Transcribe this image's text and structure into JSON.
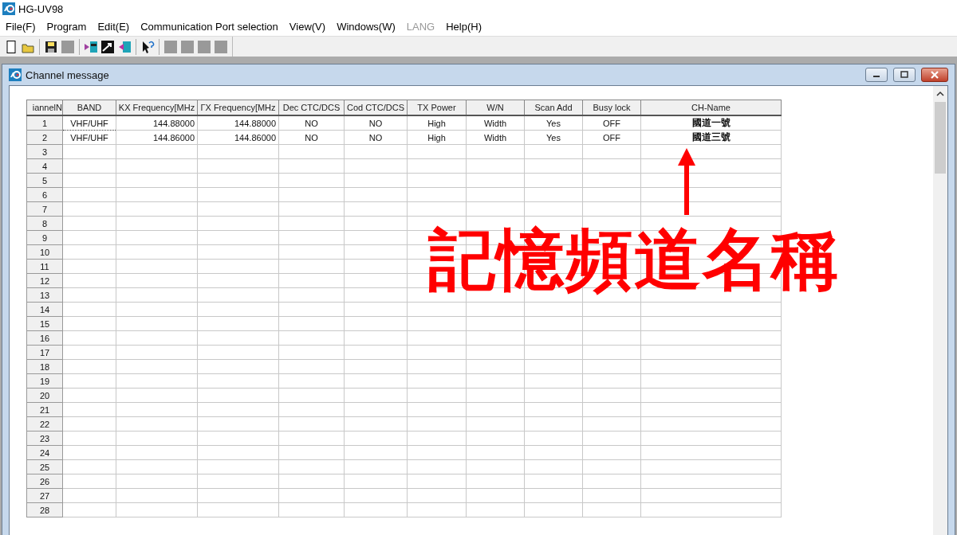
{
  "window": {
    "title": "HG-UV98"
  },
  "menu": [
    {
      "label": "File(F)",
      "disabled": false
    },
    {
      "label": "Program",
      "disabled": false
    },
    {
      "label": "Edit(E)",
      "disabled": false
    },
    {
      "label": "Communication Port selection",
      "disabled": false
    },
    {
      "label": "View(V)",
      "disabled": false
    },
    {
      "label": "Windows(W)",
      "disabled": false
    },
    {
      "label": "LANG",
      "disabled": true
    },
    {
      "label": "Help(H)",
      "disabled": false
    }
  ],
  "toolbar": [
    {
      "kind": "new"
    },
    {
      "kind": "open"
    },
    {
      "kind": "sep"
    },
    {
      "kind": "save"
    },
    {
      "kind": "blank"
    },
    {
      "kind": "sep"
    },
    {
      "kind": "read"
    },
    {
      "kind": "write"
    },
    {
      "kind": "transfer"
    },
    {
      "kind": "sep"
    },
    {
      "kind": "help"
    },
    {
      "kind": "sep"
    },
    {
      "kind": "blank"
    },
    {
      "kind": "blank"
    },
    {
      "kind": "blank"
    },
    {
      "kind": "blank"
    }
  ],
  "child_window": {
    "title": "Channel message"
  },
  "table": {
    "columns": [
      "iannelN",
      "BAND",
      "ΚX Frequency[MHz",
      "ΓX Frequency[MHz",
      "Dec CTC/DCS",
      "Cod CTC/DCS",
      "TX Power",
      "W/N",
      "Scan Add",
      "Busy lock",
      "CH-Name"
    ],
    "rows": [
      {
        "cells": [
          "1",
          "VHF/UHF",
          "144.88000",
          "144.88000",
          "NO",
          "NO",
          "High",
          "Width",
          "Yes",
          "OFF",
          "國道一號"
        ]
      },
      {
        "cells": [
          "2",
          "VHF/UHF",
          "144.86000",
          "144.86000",
          "NO",
          "NO",
          "High",
          "Width",
          "Yes",
          "OFF",
          "國道三號"
        ]
      },
      {
        "cells": [
          "3"
        ]
      },
      {
        "cells": [
          "4"
        ]
      },
      {
        "cells": [
          "5"
        ]
      },
      {
        "cells": [
          "6"
        ]
      },
      {
        "cells": [
          "7"
        ]
      },
      {
        "cells": [
          "8"
        ]
      },
      {
        "cells": [
          "9"
        ]
      },
      {
        "cells": [
          "10"
        ]
      },
      {
        "cells": [
          "11"
        ]
      },
      {
        "cells": [
          "12"
        ]
      },
      {
        "cells": [
          "13"
        ]
      },
      {
        "cells": [
          "14"
        ]
      },
      {
        "cells": [
          "15"
        ]
      },
      {
        "cells": [
          "16"
        ]
      },
      {
        "cells": [
          "17"
        ]
      },
      {
        "cells": [
          "18"
        ]
      },
      {
        "cells": [
          "19"
        ]
      },
      {
        "cells": [
          "20"
        ]
      },
      {
        "cells": [
          "21"
        ]
      },
      {
        "cells": [
          "22"
        ]
      },
      {
        "cells": [
          "23"
        ]
      },
      {
        "cells": [
          "24"
        ]
      },
      {
        "cells": [
          "25"
        ]
      },
      {
        "cells": [
          "26"
        ]
      },
      {
        "cells": [
          "27"
        ]
      },
      {
        "cells": [
          "28"
        ]
      }
    ]
  },
  "annotation": {
    "text": "記憶頻道名稱"
  }
}
